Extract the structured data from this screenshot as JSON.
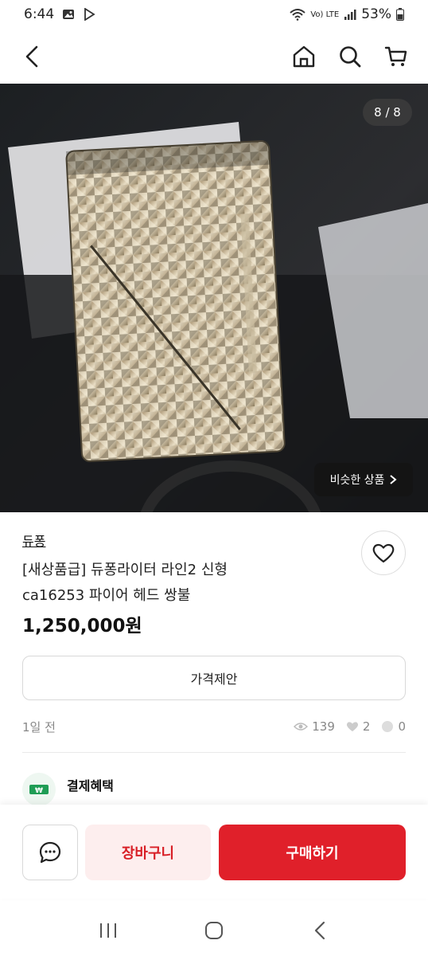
{
  "status_bar": {
    "time": "6:44",
    "battery": "53%",
    "network_label": "Vo) LTE"
  },
  "top_nav": {
    "icons": [
      "back-icon",
      "home-icon",
      "search-icon",
      "cart-icon"
    ]
  },
  "gallery": {
    "counter": "8 / 8",
    "similar_button": "비슷한 상품"
  },
  "product": {
    "brand": "듀퐁",
    "title_line1": "[새상품급] 듀퐁라이터 라인2 신형",
    "title_line2": "ca16253 파이어 헤드 쌍불",
    "price": "1,250,000원"
  },
  "actions": {
    "offer_button": "가격제안"
  },
  "meta": {
    "posted": "1일 전",
    "views": "139",
    "likes": "2",
    "chats": "0"
  },
  "benefits": {
    "label": "결제혜택",
    "icon_text": "₩"
  },
  "bottom_bar": {
    "cart_button": "장바구니",
    "buy_button": "구매하기"
  },
  "colors": {
    "accent": "#e0202a",
    "accent_soft": "#fdeeee",
    "benefit_green": "#1f9d55"
  }
}
